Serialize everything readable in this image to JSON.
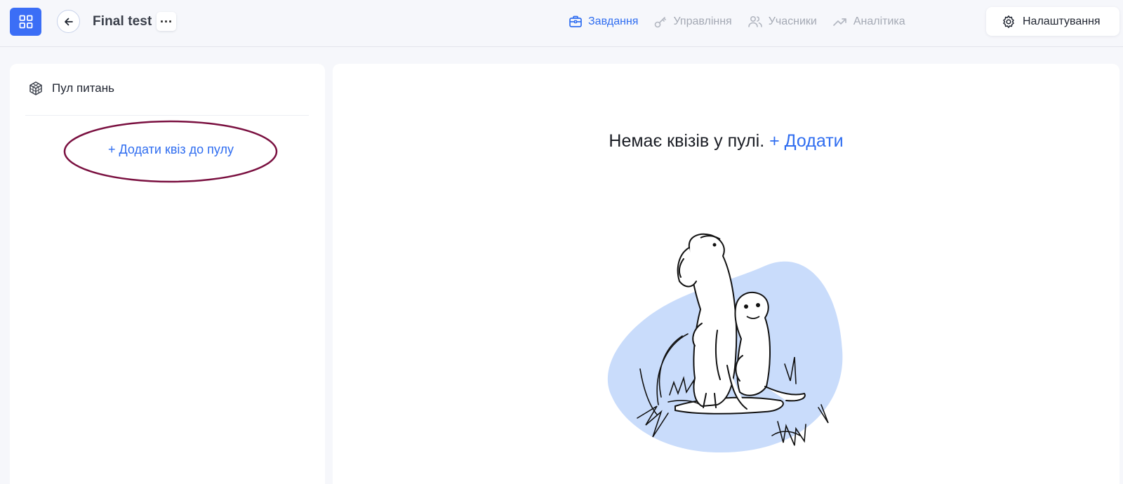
{
  "header": {
    "title": "Final test",
    "more_label": "···",
    "tabs": [
      {
        "label": "Завдання",
        "icon": "briefcase-icon",
        "active": true
      },
      {
        "label": "Управління",
        "icon": "key-icon",
        "active": false
      },
      {
        "label": "Учасники",
        "icon": "users-icon",
        "active": false
      },
      {
        "label": "Аналітика",
        "icon": "trend-up-icon",
        "active": false
      }
    ],
    "settings_label": "Налаштування"
  },
  "sidebar": {
    "title": "Пул питань",
    "add_quiz_label": "+ Додати квіз до пулу"
  },
  "main": {
    "empty_text": "Немає квізів у пулі.",
    "add_label": "+ Додати"
  },
  "colors": {
    "accent": "#2f6df0",
    "apps_button": "#3b6ef6",
    "annotation": "#7a1040",
    "illustration_blob": "#c9dcfb"
  }
}
